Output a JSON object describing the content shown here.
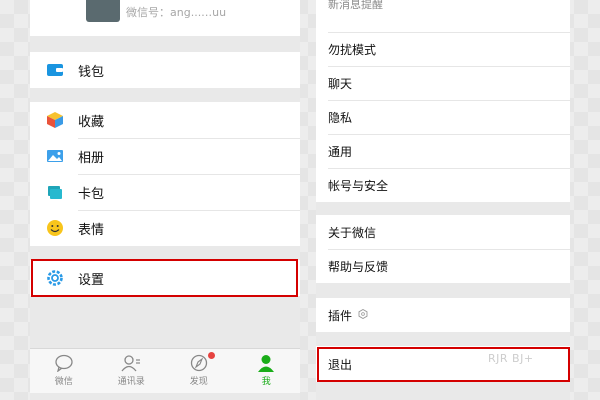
{
  "left": {
    "profile_wxid": "微信号：ang...…uu",
    "wallet": {
      "items": [
        {
          "label": "钱包",
          "icon": "wallet-icon"
        }
      ]
    },
    "collection": {
      "items": [
        {
          "label": "收藏",
          "icon": "cube-icon"
        },
        {
          "label": "相册",
          "icon": "photo-icon"
        },
        {
          "label": "卡包",
          "icon": "card-icon"
        },
        {
          "label": "表情",
          "icon": "smile-icon"
        }
      ]
    },
    "settings": {
      "label": "设置",
      "icon": "gear-icon"
    },
    "tabs": [
      {
        "label": "微信",
        "icon": "chat-icon"
      },
      {
        "label": "通讯录",
        "icon": "contacts-icon"
      },
      {
        "label": "发现",
        "icon": "compass-icon",
        "badge": true
      },
      {
        "label": "我",
        "icon": "me-icon",
        "active": true
      }
    ],
    "colors": {
      "accent": "#1aad19",
      "badge": "#e64340"
    }
  },
  "right": {
    "partial_top_label": "新消息提醒",
    "group1": [
      "勿扰模式",
      "聊天",
      "隐私",
      "通用",
      "帐号与安全"
    ],
    "group2": [
      "关于微信",
      "帮助与反馈"
    ],
    "plugin_label": "插件",
    "logout_label": "退出"
  },
  "highlight_color": "#d40000",
  "watermark": "RJR BJ+"
}
